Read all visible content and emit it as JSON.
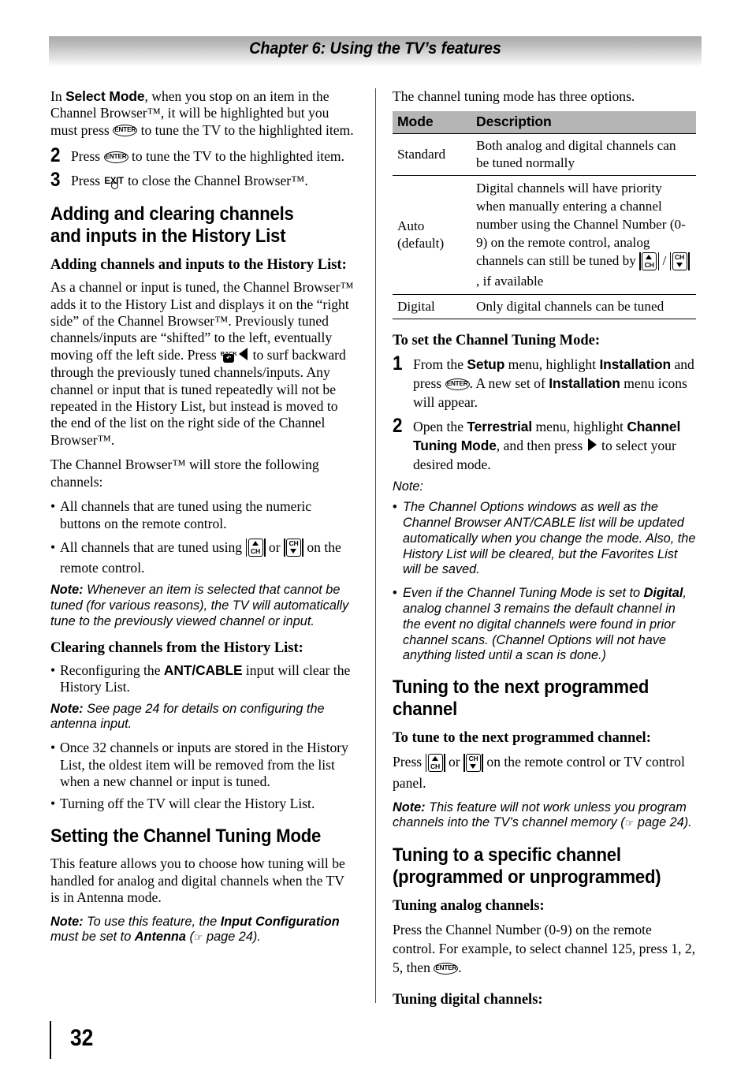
{
  "header": {
    "chapter_title": "Chapter 6: Using the TV’s features"
  },
  "page_number": "32",
  "icons": {
    "enter": "ENTER",
    "exit": "EXIT",
    "back": "BACK",
    "back_glyph": "↶",
    "ch": "CH",
    "hand": "☞"
  },
  "left_column": {
    "intro": {
      "part1": "In ",
      "bold1": "Select Mode",
      "part2": ", when you stop on an item in the Channel Browser™, it will be highlighted but you must press ",
      "part3": " to tune the TV to the highlighted item."
    },
    "step2": {
      "number": "2",
      "part1": "Press ",
      "part2": " to tune the TV to the highlighted item."
    },
    "step3": {
      "number": "3",
      "part1": "Press ",
      "part2": " to close the Channel Browser™."
    },
    "heading_adding_clearing": "Adding and clearing channels and inputs in the History List",
    "subheading_adding": "Adding channels and inputs to the History List:",
    "para_adding": {
      "part1": "As a channel or input is tuned, the Channel Browser™ adds it to the History List and displays it on the “right side” of the Channel Browser™. Previously tuned channels/inputs are “shifted” to the left, eventually moving off the left side. Press ",
      "part2": " to surf backward through the previously tuned channels/inputs. Any channel or input that is tuned repeatedly will not be repeated in the History List, but instead is moved to the end of the list on the right side of the Channel Browser™."
    },
    "para_store": "The Channel Browser™ will store the following channels:",
    "bullets_store": [
      {
        "text": "All channels that are tuned using the numeric buttons on the remote control."
      },
      {
        "part1": "All channels that are tuned using ",
        "part2": " or ",
        "part3": " on the remote control."
      }
    ],
    "note_cannot_tune": {
      "label": "Note:",
      "text": " Whenever an item is selected that cannot be tuned (for various reasons), the TV will automatically tune to the previously viewed channel or input."
    },
    "subheading_clearing": "Clearing channels from the History List:",
    "bullet_reconfiguring": {
      "part1": "Reconfiguring the ",
      "bold": "ANT/CABLE",
      "part2": " input will clear the History List."
    },
    "note_see_page": {
      "label": "Note:",
      "text": " See page 24 for details on configuring the antenna input."
    },
    "bullets_clearing": [
      "Once 32 channels or inputs are stored in the History List, the oldest item will be removed from the list when a new channel or input is tuned.",
      "Turning off the TV will clear the History List."
    ],
    "heading_setting_mode": "Setting the Channel Tuning Mode",
    "para_setting_mode": "This feature allows you to choose how tuning will be handled for analog and digital channels when the TV is in Antenna mode.",
    "note_input_config": {
      "label": "Note:",
      "part1": " To use this feature, the ",
      "bold1": "Input Configuration",
      "part2": " must be set to ",
      "bold2": "Antenna",
      "part3": " (",
      "part4": " page 24)."
    }
  },
  "right_column": {
    "intro": "The channel tuning mode has three options.",
    "table": {
      "headers": [
        "Mode",
        "Description"
      ],
      "rows": [
        {
          "mode": "Standard",
          "description": "Both analog and digital channels can be tuned normally"
        },
        {
          "mode": "Auto (default)",
          "mode_line1": "Auto",
          "mode_line2": "(default)",
          "desc_part1": "Digital channels will have priority when manually entering a channel number using the Channel Number (0-9) on the remote control, analog channels can still be tuned by ",
          "desc_sep": " / ",
          "desc_part2": ", if available"
        },
        {
          "mode": "Digital",
          "description": "Only digital channels can be tuned"
        }
      ]
    },
    "subheading_to_set": "To set the Channel Tuning Mode:",
    "step1": {
      "number": "1",
      "part1": "From the ",
      "bold1": "Setup",
      "part2": " menu, highlight ",
      "bold2": "Installation",
      "part3": " and press ",
      "part4": ". A new set of ",
      "bold3": "Installation",
      "part5": " menu icons will appear."
    },
    "step2": {
      "number": "2",
      "part1": "Open the ",
      "bold1": "Terrestrial",
      "part2": " menu, highlight ",
      "bold2": "Channel Tuning Mode",
      "part3": ", and then press ",
      "part4": " to select your desired mode."
    },
    "note_label": "Note:",
    "note_bullets": [
      {
        "text": "The Channel Options windows as well as the Channel Browser ANT/CABLE list will be updated automatically when you change the mode. Also, the History List will be cleared, but the Favorites List will be saved."
      },
      {
        "part1": "Even if the Channel Tuning Mode is set to ",
        "bold": "Digital",
        "part2": ", analog channel 3 remains the default channel in the event no digital channels were found in prior channel scans. (Channel Options will not have anything listed until a scan is done.)"
      }
    ],
    "heading_next_channel": "Tuning to the next programmed channel",
    "subheading_to_tune_next": "To tune to the next programmed channel:",
    "para_press": {
      "part1": "Press ",
      "part2": " or ",
      "part3": " on the remote control or TV control panel."
    },
    "note_program": {
      "label": "Note:",
      "part1": " This feature will not work unless you program channels into the TV’s channel memory (",
      "part2": " page 24)."
    },
    "heading_specific_channel": "Tuning to a specific channel (programmed or unprogrammed)",
    "subheading_analog": "Tuning analog channels:",
    "para_analog": {
      "part1": "Press the Channel Number (0-9) on the remote control. For example, to select channel 125, press 1, 2, 5, then ",
      "part2": "."
    },
    "subheading_digital": "Tuning digital channels:"
  }
}
